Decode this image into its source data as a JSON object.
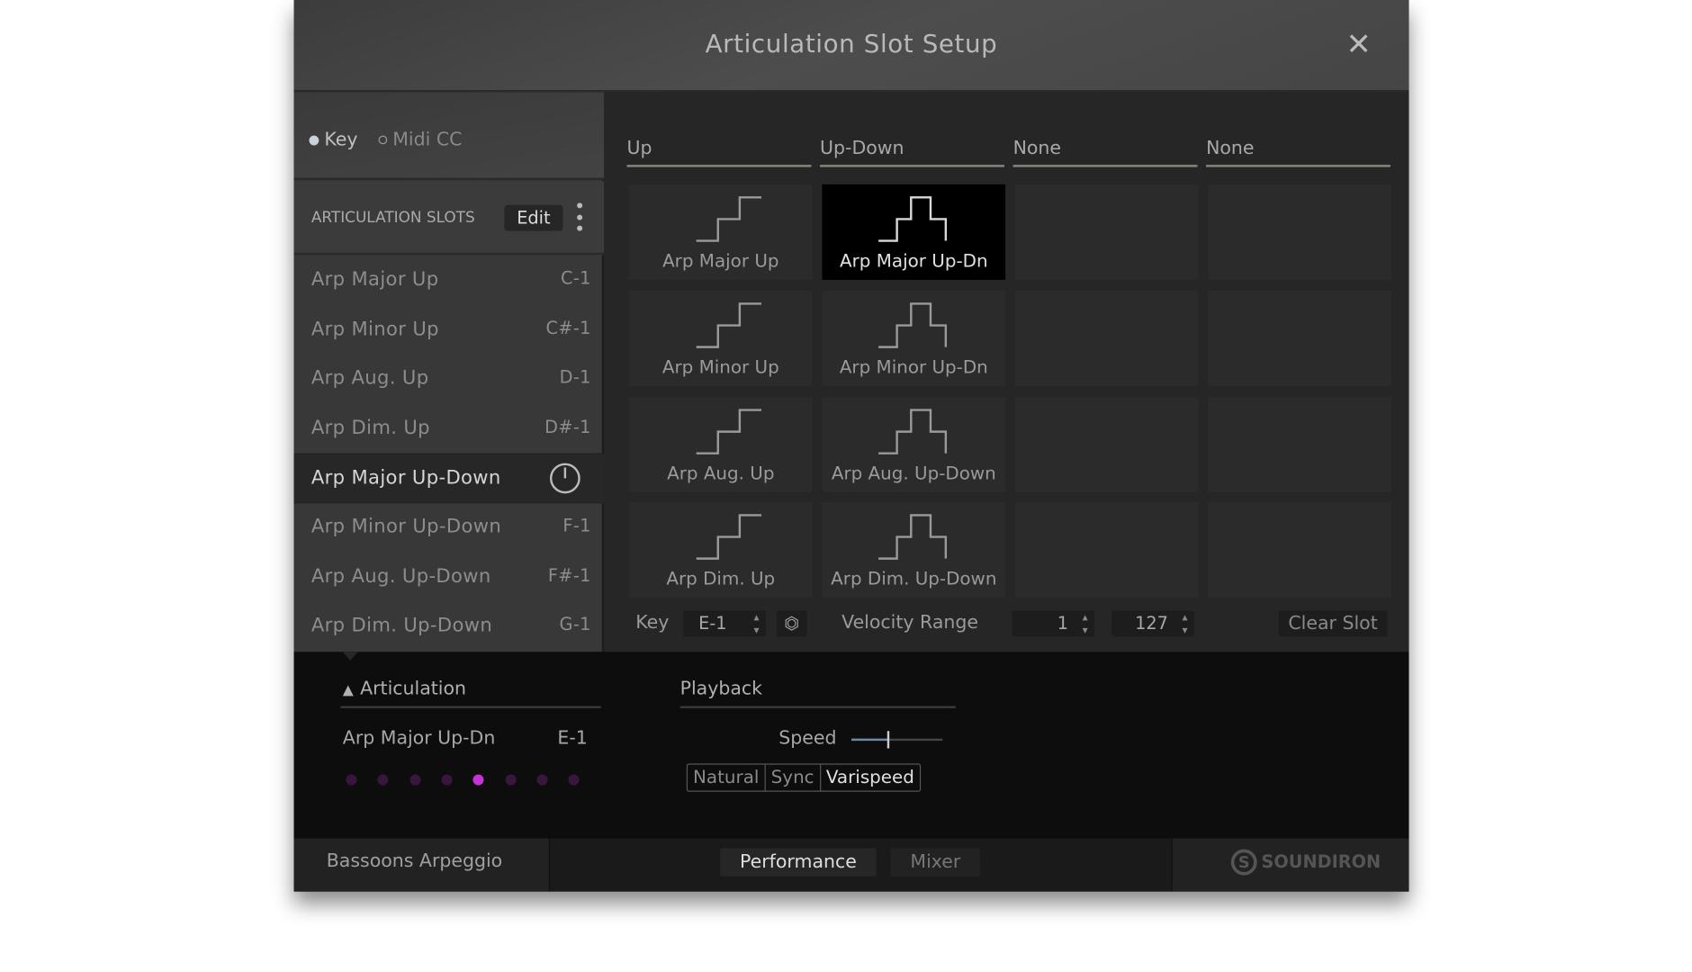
{
  "window": {
    "title": "Articulation Slot Setup",
    "close_icon": "close-icon"
  },
  "mode": {
    "options": [
      "Key",
      "Midi CC"
    ],
    "selected": "Key"
  },
  "slots_header": {
    "label": "ARTICULATION SLOTS",
    "edit_label": "Edit"
  },
  "slots": [
    {
      "name": "Arp Major Up",
      "key": "C-1"
    },
    {
      "name": "Arp Minor Up",
      "key": "C#-1"
    },
    {
      "name": "Arp Aug. Up",
      "key": "D-1"
    },
    {
      "name": "Arp Dim. Up",
      "key": "D#-1"
    },
    {
      "name": "Arp Major Up-Down",
      "key": ""
    },
    {
      "name": "Arp Minor Up-Down",
      "key": "F-1"
    },
    {
      "name": "Arp Aug. Up-Down",
      "key": "F#-1"
    },
    {
      "name": "Arp Dim. Up-Down",
      "key": "G-1"
    }
  ],
  "grid": {
    "columns": [
      "Up",
      "Up-Down",
      "None",
      "None"
    ],
    "cells": [
      [
        "Arp Major Up",
        "Arp Major Up-Dn",
        "",
        ""
      ],
      [
        "Arp Minor Up",
        "Arp Minor Up-Dn",
        "",
        ""
      ],
      [
        "Arp Aug. Up",
        "Arp Aug. Up-Down",
        "",
        ""
      ],
      [
        "Arp Dim. Up",
        "Arp Dim. Up-Down",
        "",
        ""
      ]
    ],
    "selected": "Arp Major Up-Dn"
  },
  "slot_controls": {
    "key_label": "Key",
    "key_value": "E-1",
    "velocity_label": "Velocity Range",
    "velocity_min": "1",
    "velocity_max": "127",
    "clear_label": "Clear Slot"
  },
  "articulation": {
    "header": "Articulation",
    "name": "Arp Major Up-Dn",
    "key": "E-1",
    "dot_count": 8,
    "active_dot": 4
  },
  "playback": {
    "header": "Playback",
    "speed_label": "Speed",
    "speed_value": 0.4,
    "modes": [
      "Natural",
      "Sync",
      "Varispeed"
    ],
    "selected_mode": "Varispeed"
  },
  "footer": {
    "instrument": "Bassoons Arpeggio",
    "tabs": [
      "Performance",
      "Mixer"
    ],
    "active_tab": "Performance",
    "brand": "SOUNDIRON"
  },
  "colors": {
    "accent": "#c433d6",
    "background": "#262626"
  }
}
